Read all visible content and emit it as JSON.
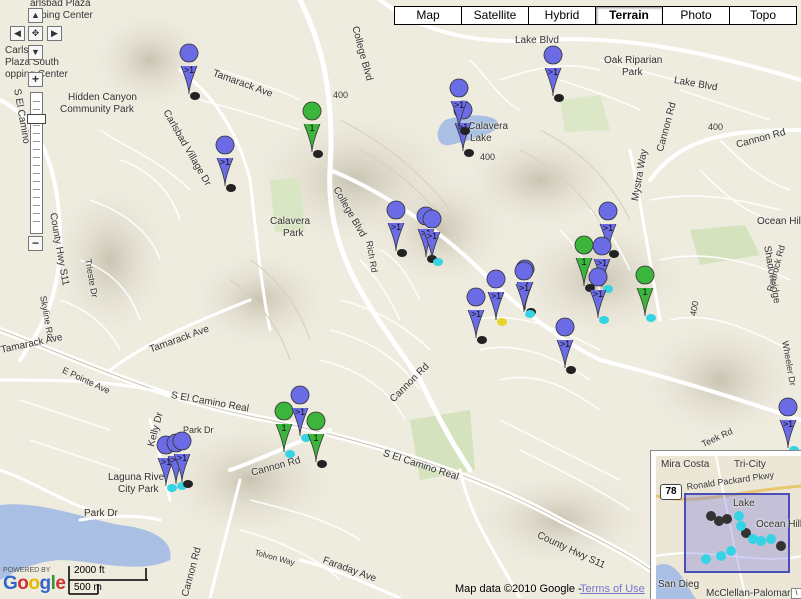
{
  "map_types": [
    {
      "label": "Map",
      "active": false
    },
    {
      "label": "Satellite",
      "active": false
    },
    {
      "label": "Hybrid",
      "active": false
    },
    {
      "label": "Terrain",
      "active": true
    },
    {
      "label": "Photo",
      "active": false
    },
    {
      "label": "Topo",
      "active": false
    }
  ],
  "labels": {
    "carlsbad_plaza": "arlsbad Plaza",
    "opping_center_top": "opping Center",
    "carls": "Carls",
    "plaza_south": "Plaza South",
    "opping_center": "opping Center",
    "hidden_canyon": "Hidden Canyon",
    "community_park": "Community Park",
    "tamarack_ave_top": "Tamarack Ave",
    "carlsbad_village_dr": "Carlsbad Village Dr",
    "college_blvd_top": "College Blvd",
    "lake_blvd_top": "Lake Blvd",
    "lake_blvd_right": "Lake Blvd",
    "oak_riparian": "Oak Riparian",
    "park": "Park",
    "calavera_lake_1": "Calavera",
    "calavera_lake_2": "Lake",
    "elev_400_a": "400",
    "elev_400_b": "400",
    "elev_400_c": "400",
    "calavera_park_1": "Calavera",
    "calavera_park_2": "Park",
    "college_blvd_mid": "College Blvd",
    "cannon_rd_top": "Cannon Rd",
    "mystra_way": "Mystra Way",
    "cannon_rd_right": "Cannon Rd",
    "ocean_hill": "Ocean Hill",
    "shadowridge": "Shadowridge",
    "county_hwy_s11": "County Hwy S11",
    "trieste_dr": "Trieste Dr",
    "skyline_rd": "Skyline Rd",
    "s_el_camino": "S El Camino",
    "tamarack_ave_mid": "Tamarack Ave",
    "tamarack_ave_left": "Tamarack Ave",
    "e_pointe_ave": "E Pointe Ave",
    "rich_rd": "Rich Rd",
    "cannon_rd_mid": "Cannon Rd",
    "s_el_camino_real_1": "S El Camino Real",
    "kelly_dr": "Kelly Dr",
    "park_dr_1": "Park Dr",
    "laguna_riviera": "Laguna Rive",
    "city_park": "City Park",
    "cannon_rd_low": "Cannon Rd",
    "s_el_camino_real_2": "S El Camino Real",
    "county_hwy_s11_low": "County Hwy S11",
    "park_dr_low": "Park Dr",
    "faraday_ave": "Faraday Ave",
    "cannon_rd_bottom": "Cannon Rd",
    "tolvon_way": "Tolvon Way",
    "elev_400_d": "400",
    "redrock_rd": "Redrock Rd",
    "teek_rd": "Teek Rd",
    "wheeler_dr": "Wheeler Dr"
  },
  "overview": {
    "mira_costa": "Mira Costa",
    "tri_city": "Tri-City",
    "hwy": "78",
    "ronald_packard": "Ronald Packard Pkwy",
    "lake": "Lake",
    "ocean_hill": "Ocean Hill",
    "san_diego": "San Dieg",
    "mcclellan": "McClellan-Palomar",
    "close": "\\"
  },
  "markers": [
    {
      "kind": "blue",
      "text": ">1",
      "shadow": "black"
    },
    {
      "kind": "blue",
      "text": ">1",
      "shadow": "black"
    },
    {
      "kind": "blue",
      "text": ">1",
      "shadow": "black"
    },
    {
      "kind": "green",
      "text": "1",
      "shadow": "black"
    },
    {
      "kind": "blue",
      "text": ">1",
      "shadow": "black"
    },
    {
      "kind": "blue",
      "text": ">1",
      "shadow": "black"
    },
    {
      "kind": "blue",
      "text": ">1",
      "shadow": "black"
    },
    {
      "kind": "blue",
      "text": ">1",
      "shadow": "black"
    },
    {
      "kind": "blue",
      "text": ">1",
      "shadow": "cyan"
    },
    {
      "kind": "blue",
      "text": ">1",
      "shadow": "black"
    },
    {
      "kind": "green",
      "text": "1",
      "shadow": "black"
    },
    {
      "kind": "blue",
      "text": ">1",
      "shadow": "cyan"
    },
    {
      "kind": "blue",
      "text": ">1",
      "shadow": "cyan"
    },
    {
      "kind": "green",
      "text": "1",
      "shadow": "cyan"
    },
    {
      "kind": "blue",
      "text": ">1",
      "shadow": "black"
    },
    {
      "kind": "blue",
      "text": ">1",
      "shadow": "yellow"
    },
    {
      "kind": "blue",
      "text": ">1",
      "shadow": "cyan"
    },
    {
      "kind": "blue",
      "text": ">1",
      "shadow": "black"
    },
    {
      "kind": "blue",
      "text": ">1",
      "shadow": "black"
    },
    {
      "kind": "green",
      "text": "1",
      "shadow": "cyan"
    },
    {
      "kind": "blue",
      "text": ">1",
      "shadow": "cyan"
    },
    {
      "kind": "green",
      "text": "1",
      "shadow": "black"
    },
    {
      "kind": "blue",
      "text": ">1",
      "shadow": "cyan"
    },
    {
      "kind": "blue",
      "text": ">1",
      "shadow": "cyan"
    },
    {
      "kind": "blue",
      "text": ">1",
      "shadow": "black"
    },
    {
      "kind": "blue",
      "text": ">1",
      "shadow": "cyan"
    }
  ],
  "colors": {
    "blue_marker": "#6b6be6",
    "green_marker": "#3cb53c",
    "cyan_dot": "#36d3e4",
    "yellow_dot": "#e5d52a",
    "water": "#a9bfe3",
    "park": "#cfe5b5",
    "road": "#ffffff",
    "overview_box": "#4a4fb3"
  },
  "scale": {
    "ft": "2000 ft",
    "m": "500 m"
  },
  "footer": {
    "powered_by": "POWERED BY",
    "copyright": "Map data ©2010 Google -",
    "terms": "Terms of Use"
  },
  "nav": {
    "up": "▲",
    "down": "▼",
    "left": "◀",
    "right": "▶",
    "center": "✥",
    "zoom_in": "+",
    "zoom_out": "−"
  }
}
